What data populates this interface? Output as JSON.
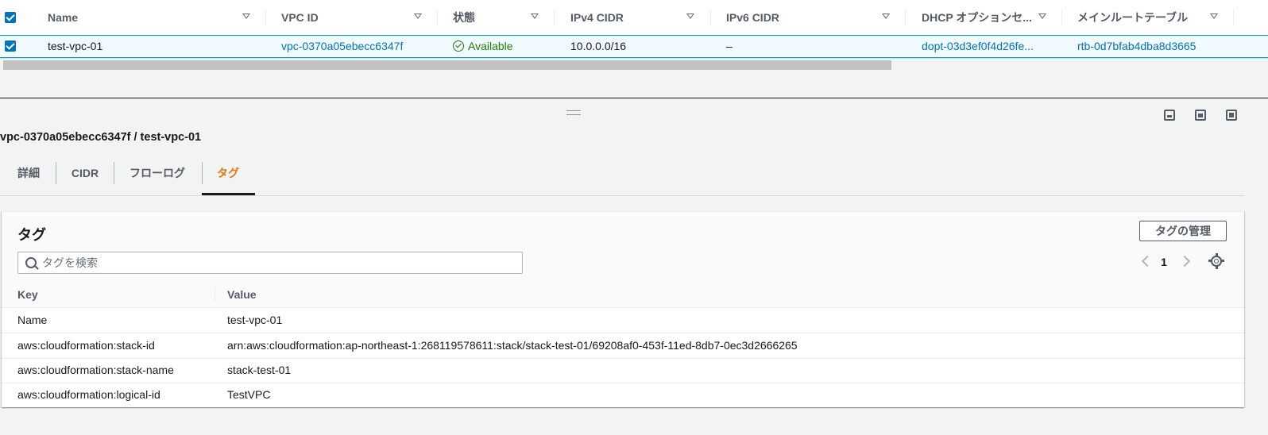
{
  "vpc_table": {
    "columns": [
      "Name",
      "VPC ID",
      "状態",
      "IPv4 CIDR",
      "IPv6 CIDR",
      "DHCP オプションセ...",
      "メインルートテーブル"
    ],
    "row": {
      "name": "test-vpc-01",
      "vpc_id": "vpc-0370a05ebecc6347f",
      "state": "Available",
      "ipv4_cidr": "10.0.0.0/16",
      "ipv6_cidr": "–",
      "dhcp_options": "dopt-03d3ef0f4d26fe...",
      "main_route_table": "rtb-0d7bfab4dba8d3665"
    }
  },
  "split_panel": {
    "title": "vpc-0370a05ebecc6347f / test-vpc-01",
    "tabs": [
      "詳細",
      "CIDR",
      "フローログ",
      "タグ"
    ],
    "active_tab": "タグ"
  },
  "tags": {
    "title": "タグ",
    "manage_button": "タグの管理",
    "search_placeholder": "タグを検索",
    "page": "1",
    "headers": {
      "key": "Key",
      "value": "Value"
    },
    "rows": [
      {
        "key": "Name",
        "value": "test-vpc-01"
      },
      {
        "key": "aws:cloudformation:stack-id",
        "value": "arn:aws:cloudformation:ap-northeast-1:268119578611:stack/stack-test-01/69208af0-453f-11ed-8db7-0ec3d2666265"
      },
      {
        "key": "aws:cloudformation:stack-name",
        "value": "stack-test-01"
      },
      {
        "key": "aws:cloudformation:logical-id",
        "value": "TestVPC"
      }
    ]
  },
  "colors": {
    "link": "#0073bb",
    "active_tab": "#ec7211",
    "status_ok": "#1d8102",
    "selected_row": "#f1faff"
  }
}
